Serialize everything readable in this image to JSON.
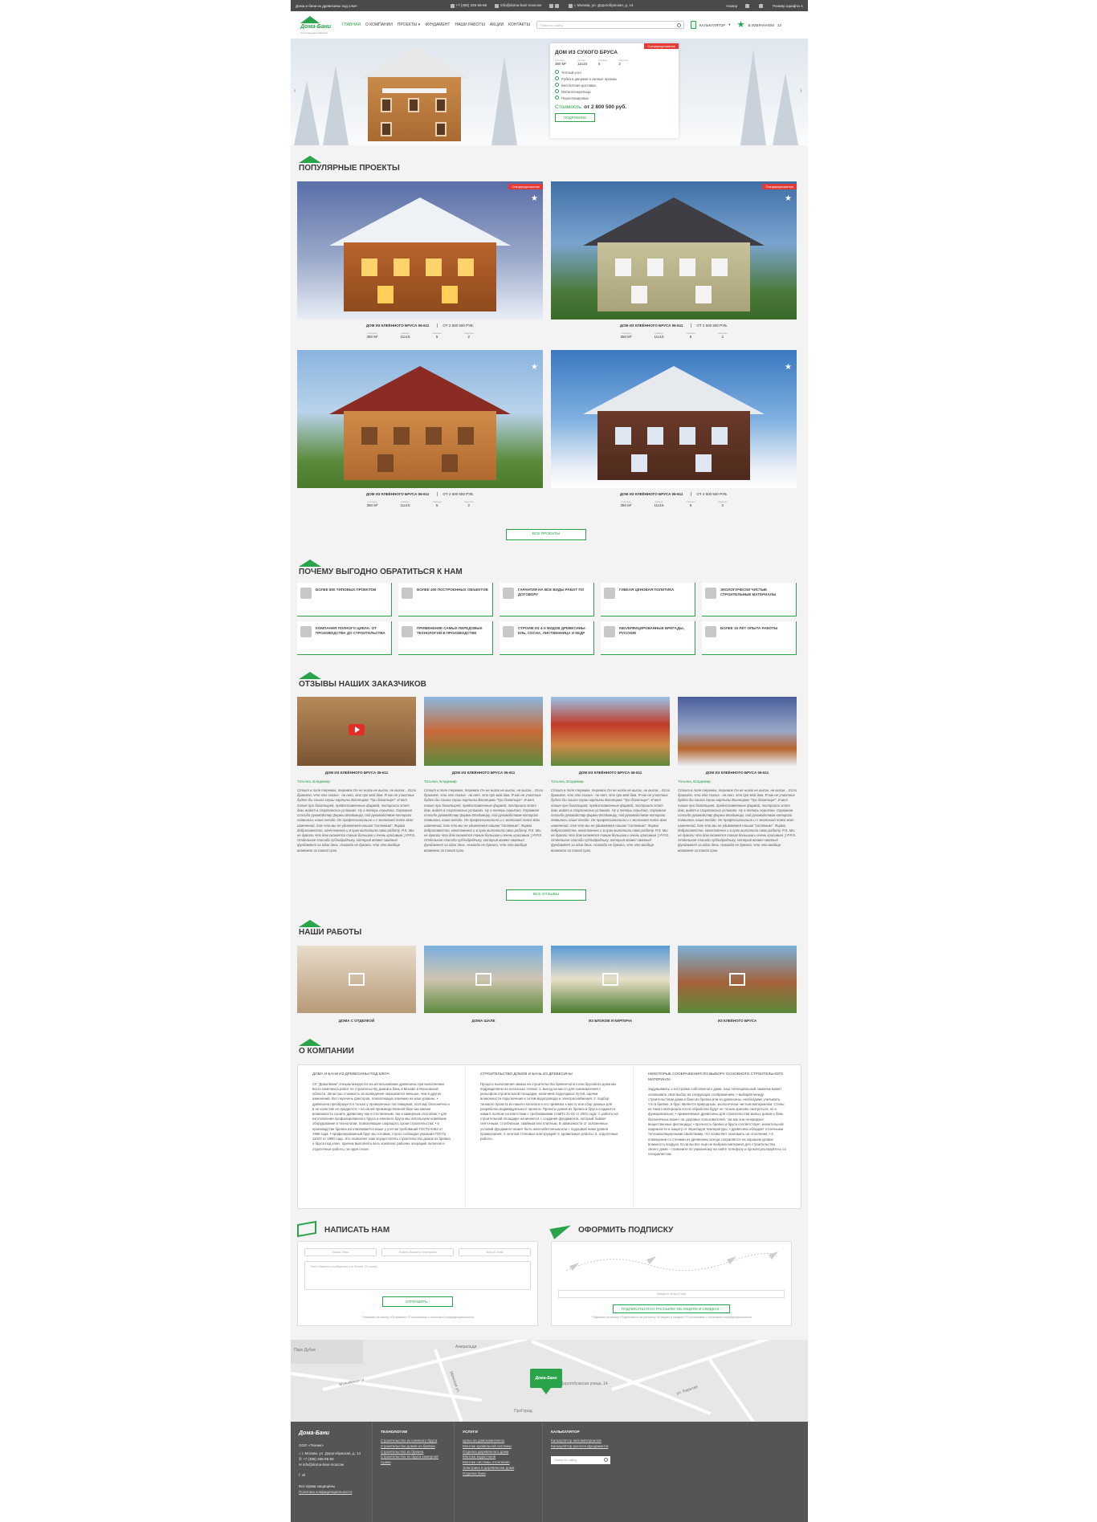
{
  "topbar": {
    "tagline": "Дома и бани из древесины под ключ",
    "phone": "+7 (495) 266-66-66",
    "email": "info@doma-bani-moscow",
    "address": "г. Москва, ул. Дорогобужская, д. 14",
    "login": "Номер",
    "font_size": "Размер шрифта А"
  },
  "header": {
    "logo_text": "Дома-Бани",
    "logo_sub": "Строительная компания",
    "nav": [
      "ГЛАВНАЯ",
      "О КОМПАНИИ",
      "ПРОЕКТЫ",
      "ФУНДАМЕНТ",
      "НАШИ РАБОТЫ",
      "АКЦИИ",
      "КОНТАКТЫ"
    ],
    "search_placeholder": "Поиск по сайту",
    "calculator": "КАЛЬКУЛЯТОР",
    "favorites": "В ИЗБРАННОМ",
    "favorites_count": "12"
  },
  "hero": {
    "badge": "Спецпредложение",
    "title": "ДОМ ИЗ СУХОГО БРУСА",
    "specs": [
      {
        "label": "площадь",
        "value": "350 М²"
      },
      {
        "label": "размер",
        "value": "11х15"
      },
      {
        "label": "спальни",
        "value": "5"
      },
      {
        "label": "санузлы",
        "value": "2"
      }
    ],
    "features": [
      "Теплый угол",
      "Рубка в двержке и окнные проемы",
      "Бесплатная доставка",
      "Металлочерепица",
      "Перепланировка"
    ],
    "cost_label": "Стоимость:",
    "cost_value": "от 2 800 500 руб.",
    "button": "ПОДРОБНЕЕ"
  },
  "popular": {
    "title": "ПОПУЛЯРНЫЕ ПРОЕКТЫ",
    "items": [
      {
        "name": "ДОМ ИЗ КЛЕЁННОГО БРУСА 06-611",
        "price": "от 2 500 500 руб.",
        "badge": "Спецпредложение",
        "specs": [
          {
            "label": "площадь",
            "value": "350 М²"
          },
          {
            "label": "размер",
            "value": "11х15"
          },
          {
            "label": "спальни",
            "value": "5"
          },
          {
            "label": "санузлы",
            "value": "2"
          }
        ]
      },
      {
        "name": "ДОМ ИЗ КЛЕЁННОГО БРУСА 06-611",
        "price": "от 2 500 500 руб.",
        "badge": "Спецпредложение",
        "specs": [
          {
            "label": "площадь",
            "value": "350 М²"
          },
          {
            "label": "размер",
            "value": "11х15"
          },
          {
            "label": "спальни",
            "value": "5"
          },
          {
            "label": "санузлы",
            "value": "2"
          }
        ]
      },
      {
        "name": "ДОМ ИЗ КЛЕЁННОГО БРУСА 06-611",
        "price": "от 2 500 500 руб.",
        "badge": "",
        "specs": [
          {
            "label": "площадь",
            "value": "350 М²"
          },
          {
            "label": "размер",
            "value": "11х15"
          },
          {
            "label": "спальни",
            "value": "5"
          },
          {
            "label": "санузлы",
            "value": "2"
          }
        ]
      },
      {
        "name": "ДОМ ИЗ КЛЕЁННОГО БРУСА 06-611",
        "price": "от 2 500 500 руб.",
        "badge": "",
        "specs": [
          {
            "label": "площадь",
            "value": "350 М²"
          },
          {
            "label": "размер",
            "value": "11х15"
          },
          {
            "label": "спальни",
            "value": "5"
          },
          {
            "label": "санузлы",
            "value": "2"
          }
        ]
      }
    ],
    "all_button": "ВСЕ ПРОЕКТЫ"
  },
  "advantages": {
    "title": "ПОЧЕМУ ВЫГОДНО ОБРАТИТЬСЯ К НАМ",
    "items": [
      "БОЛЕЕ 800 ТИПОВЫХ ПРОЕКТОВ",
      "БОЛЕЕ 400 ПОСТРОЕННЫХ ОБЪЕКТОВ",
      "ГАРАНТИЯ НА ВСЕ ВИДЫ РАБОТ ПО ДОГОВОРУ",
      "ГИБКАЯ ЦЕНОВАЯ ПОЛИТИКА",
      "ЭКОЛОГИЧЕСКИ ЧИСТЫЕ СТРОИТЕЛЬНЫЕ МАТЕРИАЛЫ",
      "КОМПАНИЯ ПОЛНОГО ЦИКЛА: ОТ ПРОИЗВОДСТВА ДО СТРОИТЕЛЬСТВА",
      "ПРИМЕНЕНИЕ САМЫХ ПЕРЕДОВЫХ ТЕХНОЛОГИЙ В ПРОИЗВОДСТВЕ",
      "СТРОИМ ИЗ 4-Х ВИДОВ ДРЕВЕСИНЫ: ЕЛЬ, СОСНА, ЛИСТВЕННИЦА И КЕДР",
      "КВАЛИФИЦИРОВАННЫЕ БРИГАДЫ, РУССКИЕ",
      "БОЛЕЕ 15 ЛЕТ ОПЫТА РАБОТЫ"
    ]
  },
  "reviews": {
    "title": "ОТЗЫВЫ НАШИХ ЗАКАЗЧИКОВ",
    "items": [
      {
        "title": "ДОМ ИЗ КЛЕЁННОГО БРУСА 06-611",
        "author": "Татьяна, Владимир",
        "text": "Стоит в поле теремок, теремок Он не низок не высок, не высок... Если бравите, что это сказка - но нет, это про мой дом. Я как не участник будто бы сошла серии картины Васнецова \"Три богатыря\". И вот такие про богатырей, предоставленные фирмой, построили этот дом, видят в спартанских условиях. Ну а теперь серьёзно. Огромное спасибо руководству фирмы Владимиру, под руководством которого появилось наше гнездо. Он профессионально и с экологией поясе всех изменений, так что мы не удивляемся нашим \"соплевым\". Фирма добросовестно, качественно и в срок выполнила свою работу. P.S. Мы не думали что дом окажется таким большим и очень красивым :) P.P.S. Отдельное спасибо субподрядчику, который возвел свайный фундамент за один день. Никогда не думала, что это вообще возможно за такой срок."
      },
      {
        "title": "ДОМ ИЗ КЛЕЁННОГО БРУСА 06-611",
        "author": "Татьяна, Владимир",
        "text": "Стоит в поле теремок, теремок Он не низок не высок, не высок... Если бравите, что это сказка - но нет, это про мой дом. Я как не участник будто бы сошла серии картины Васнецова \"Три богатыря\". И вот такие про богатырей, предоставленные фирмой, построили этот дом, видят в спартанских условиях. Ну а теперь серьёзно. Огромное спасибо руководству фирмы Владимиру, под руководством которого появилось наше гнездо. Он профессионально и с экологией поясе всех изменений, так что мы не удивляемся нашим \"соплевым\". Фирма добросовестно, качественно и в срок выполнила свою работу. P.S. Мы не думали что дом окажется таким большим и очень красивым :) P.P.S. Отдельное спасибо субподрядчику, который возвел свайный фундамент за один день. Никогда не думала, что это вообще возможно за такой срок."
      },
      {
        "title": "ДОМ ИЗ КЛЕЁННОГО БРУСА 06-611",
        "author": "Татьяна, Владимир",
        "text": "Стоит в поле теремок, теремок Он не низок не высок, не высок... Если бравите, что это сказка - но нет, это про мой дом. Я как не участник будто бы сошла серии картины Васнецова \"Три богатыря\". И вот такие про богатырей, предоставленные фирмой, построили этот дом, видят в спартанских условиях. Ну а теперь серьёзно. Огромное спасибо руководству фирмы Владимиру, под руководством которого появилось наше гнездо. Он профессионально и с экологией поясе всех изменений, так что мы не удивляемся нашим \"соплевым\". Фирма добросовестно, качественно и в срок выполнила свою работу. P.S. Мы не думали что дом окажется таким большим и очень красивым :) P.P.S. Отдельное спасибо субподрядчику, который возвел свайный фундамент за один день. Никогда не думала, что это вообще возможно за такой срок."
      },
      {
        "title": "ДОМ ИЗ КЛЕЁННОГО БРУСА 06-611",
        "author": "Татьяна, Владимир",
        "text": "Стоит в поле теремок, теремок Он не низок не высок, не высок... Если бравите, что это сказка - но нет, это про мой дом. Я как не участник будто бы сошла серии картины Васнецова \"Три богатыря\". И вот такие про богатырей, предоставленные фирмой, построили этот дом, видят в спартанских условиях. Ну а теперь серьёзно. Огромное спасибо руководству фирмы Владимиру, под руководством которого появилось наше гнездо. Он профессионально и с экологией поясе всех изменений, так что мы не удивляемся нашим \"соплевым\". Фирма добросовестно, качественно и в срок выполнила свою работу. P.S. Мы не думали что дом окажется таким большим и очень красивым :) P.P.S. Отдельное спасибо субподрядчику, который возвел свайный фундамент за один день. Никогда не думала, что это вообще возможно за такой срок."
      }
    ],
    "all_button": "ВСЕ ОТЗЫВЫ"
  },
  "works": {
    "title": "НАШИ РАБОТЫ",
    "items": [
      "ДОМА С ОТДЕЛКОЙ",
      "ДОМА ШАЛЕ",
      "ИЗ БЛОКОВ И КИРПИЧА",
      "ИЗ КЛЕЁНОГО БРУСА"
    ]
  },
  "about": {
    "title": "О КОМПАНИИ",
    "columns": [
      {
        "heading": "ДОМА И БАНИ ИЗ ДРЕВЕСИНЫ ПОД КЛЮЧ",
        "text": "СК \"Дома-Бани\" специализируется на использовании древесины при выполнении всего комплекса работ по строительству домов и бань в Москве и Московской области. Зачастую стоимость их возведения оказывается меньше, чем в других изменений. Вот перечень факторов, позволяющих влиянию на наш уровень: • древесина преобразуется только у проверенных поставщиков, поэтому бесконечно и в не качестве не придается; • на своей производственной базе мы имеем возможность сушить древесину как естественным, так и камерным способом; • для изготовления профилированного бруса и клееного бруса мы используем новейшие оборудование и технологии, позволяющие сокращать сроки строительства; • в производстве бревна изготавливается наше у учетом требований ГОСТа 9463 от 1988 года; • профилированный брус мы готовим, строго соблюдая указания ГОСТа 11047 от 1990 года. Это позволяет нам осуществлять строительство домов из бревна и бруса под ключ, причем выполнять весь комплекс рабочих операций, включая и отделочные работы, за один сезон."
      },
      {
        "heading": "СТРОИТЕЛЬСТВО ДОМОВ И БАНЬ ИЗ ДРЕВЕСИНЫ",
        "text": "Процесс выполнения заказа на строительство бревенчатого или брусового дома мы подразделяем на несколько этапов: 1. выезд на место для ознакомления с рельефом строительной площадки, наличием подъездных путей, оценки возможности подключения к сетям водопровода и электроснабжения; 2. подбор типового проекта из нашего каталога и его привязка к месту или сбор данных для разработки индивидуального проекта. Проекты домов из бревна и бруса создаются нами в полном соответствии с требованиями СНиПа 31-02 от 2001 года; 3. работы на строительной площадке начинаются с создания фундамента, который бывает ленточным, столбчатым, свайным или плитным. В зависимости от заложенных условий фундамент может быть железобетонным или с подошвой ниже уровня промерзания; 4. монтаж стеновых конструкций; 5. кровельные работы; 6. отделочные работы."
      },
      {
        "heading": "НЕКОТОРЫЕ СООБРАЖЕНИЯ ПО ВЫБОРУ ОСНОВНОГО СТРОИТЕЛЬНОГО МАТЕРИАЛА",
        "text": "Задумываясь о постройке собственного дома, наш потенциальный заказчик может основывать свой выбор на следующих соображениях: • выбирая между строительством дома и бани из бревна или из древесины, необходимо учитывать, что в бревне, и брус является природным, экологически чистым материалом. Стены из такого материала после обработки будут не только красиво смотреться, но и функционально; • применяемые древесины для строительства жилых домов и бань бесконечных может на здоровье пользователей, так как они генерируют вещественные фитонциды; • прочность бревна и бруса соответствует значительной надежности и защиту от перепадов температуры; • древесина обладает отличными теплоизоляционными свойствами, что позволяет экономить на отоплении; • в помещении со стенами из древесины всегда сохраняется на хорошем уровне влажность воздуха. Если вы все еще не выбрали материал для строительства своего дома – позвоните по указанному на сайте телефону и проконсультируйтесь со специалистом."
      }
    ]
  },
  "contact_form": {
    "title": "НАПИСАТЬ НАМ",
    "name_placeholder": "Ваше Имя",
    "phone_placeholder": "Номер Вашего телефона",
    "email_placeholder": "Ваш E-mail",
    "message_placeholder": "Текст Вашего сообщения (не более 70 слов)...",
    "button": "ОТПРАВИТЬ",
    "note": "* Нажимая на кнопку «Отправить» Я соглашаюсь с политикой конфиденциальности"
  },
  "subscribe_form": {
    "title": "ОФОРМИТЬ ПОДПИСКУ",
    "email_placeholder": "Введите Ваш Email",
    "button": "ПОДПИСАТЬСЯ НА РАССЫЛКУ ОБ АКЦИЯХ И СКИДКАХ",
    "note": "* Нажимая на кнопку «Подписаться на рассылку об акциях и скидках» Я соглашаюсь с политикой конфиденциальности"
  },
  "map": {
    "labels": [
      "Парк Дубки",
      "Можайское ш.",
      "Минская ул.",
      "Дорогобужская улица, 14",
      "ПроГород",
      "Амиральди",
      "ул. Барклая"
    ],
    "marker": "Дома-Бани"
  },
  "footer": {
    "logo_text": "Дома-Бани",
    "company": "ООО «Техник»",
    "address": "г. Москва, ул. Дорогобужская, д. 14",
    "phone": "+7 (495) 266-66-66",
    "email": "info@doma-bani-moscow",
    "copyright": "Все права защищены",
    "privacy": "Политика конфиденциальности",
    "columns": [
      {
        "heading": "ТЕХНОЛОГИИ",
        "links": [
          "Строительство из клееного бруса",
          "Строительство домов из бревна",
          "Строительство из бревна",
          "Строительство из бруса камерной сушки"
        ]
      },
      {
        "heading": "УСЛУГИ",
        "links": [
          "Цены на домокомплекты",
          "Монтаж кровельной системы",
          "Отделка деревянного дома",
          "Монтаж водостоков",
          "Монтаж системы отопления",
          "Электрика в деревянном доме",
          "Отделка бани"
        ]
      },
      {
        "heading": "КАЛЬКУЛЯТОР",
        "links": [
          "Калькулятор пиломатериалов",
          "Калькулятор расчета фундамента"
        ]
      }
    ],
    "search_placeholder": "Поиск по сайту"
  }
}
